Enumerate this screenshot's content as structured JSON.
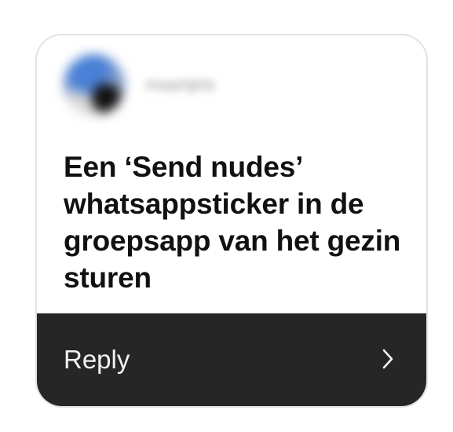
{
  "card": {
    "sender_name": "maartjels",
    "message": "Een ‘Send nudes’ whatsappsticker in de groepsapp van het gezin sturen",
    "reply_label": "Reply"
  },
  "icons": {
    "reply_chevron": "chevron-right-icon"
  },
  "colors": {
    "card_border": "#e2e2e2",
    "reply_bar": "#262626",
    "reply_text": "#f2f2f2",
    "message_text": "#111111"
  }
}
